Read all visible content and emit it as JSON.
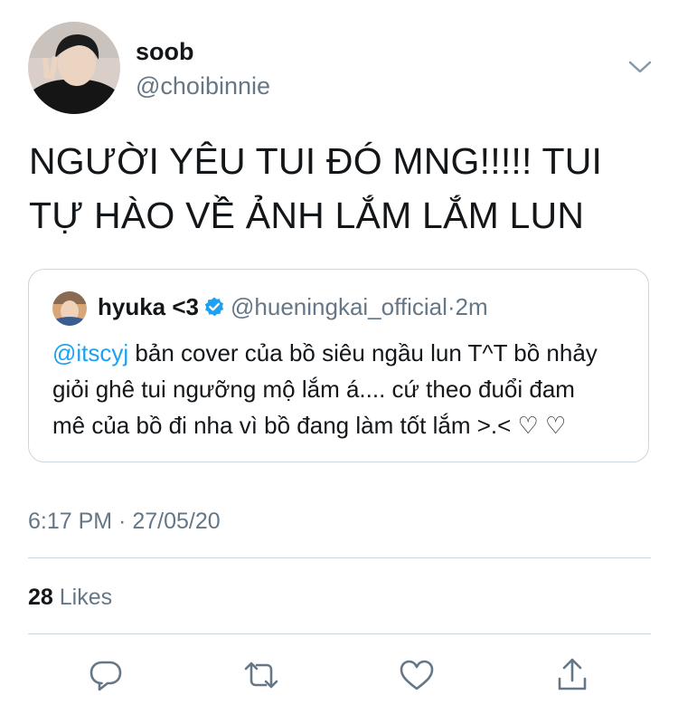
{
  "tweet": {
    "author": {
      "display_name": "soob",
      "handle": "@choibinnie"
    },
    "text_line1": "NGƯỜI YÊU TUI ĐÓ MNG!!!!! TUI",
    "text_line2": "TỰ HÀO VỀ ẢNH LẮM LẮM LUN",
    "quoted": {
      "display_name": "hyuka <3",
      "handle": "@hueningkai_official",
      "separator": "·",
      "time_ago": "2m",
      "mention": "@itscyj",
      "text_line1": "bản cover của bồ siêu ngầu lun T^T bồ nhảy",
      "text_line2": "giỏi ghê tui ngưỡng mộ lắm á.... cứ theo đuổi đam",
      "text_line3": "mê của bồ đi nha vì bồ đang làm tốt lắm >.< ♡ ♡"
    },
    "timestamp": "6:17 PM · 27/05/20",
    "likes_count": "28",
    "likes_label": "Likes"
  },
  "icons": {
    "caret": "chevron-down-icon",
    "verified": "verified-badge-icon",
    "reply": "reply-icon",
    "retweet": "retweet-icon",
    "like": "heart-icon",
    "share": "share-icon"
  },
  "colors": {
    "text_primary": "#14171a",
    "text_secondary": "#657786",
    "accent": "#1da1f2",
    "border": "#ccd6dd"
  }
}
